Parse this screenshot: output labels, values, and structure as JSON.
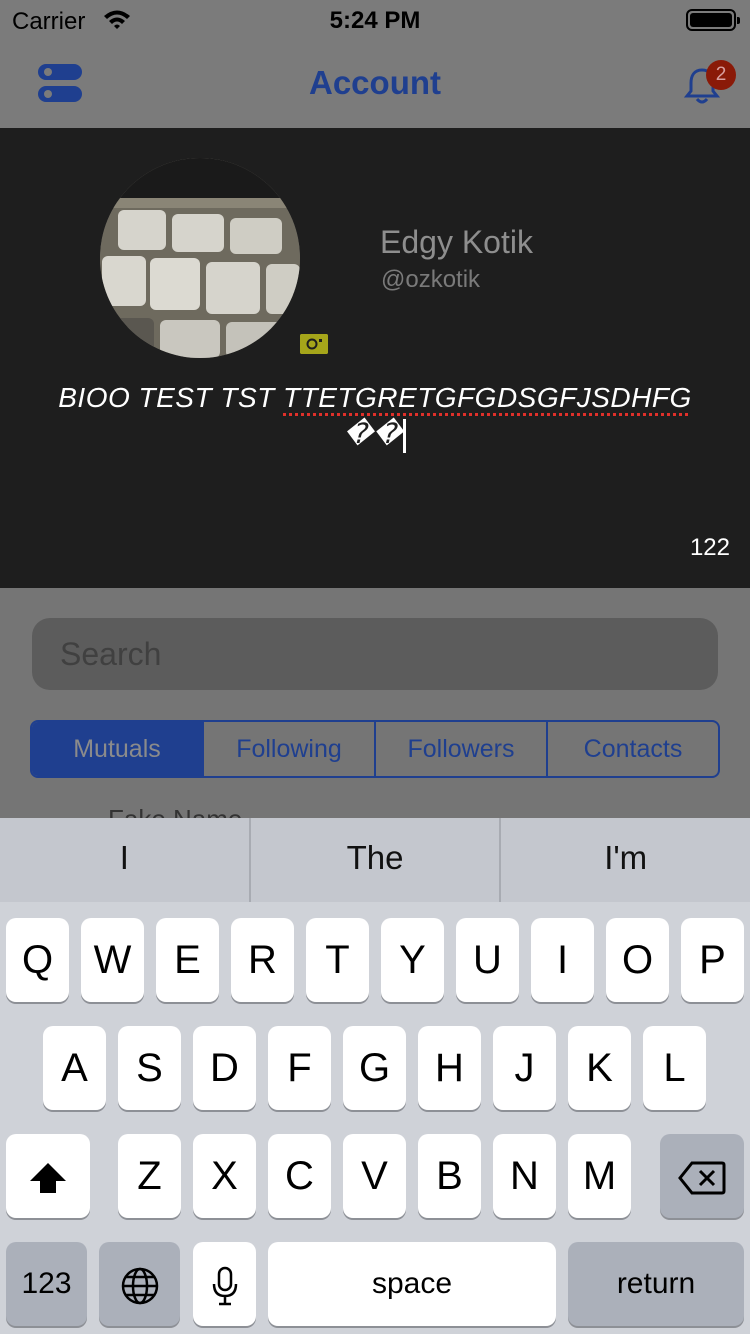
{
  "status_bar": {
    "carrier": "Carrier",
    "time": "5:24 PM"
  },
  "nav": {
    "title": "Account",
    "notification_count": "2"
  },
  "profile": {
    "name": "Edgy Kotik",
    "handle": "@ozkotik",
    "bio_plain": "BIOO TEST TST ",
    "bio_misspelled": "TTETGRETGFGDSGFJSDHFG",
    "bio_tail": "��",
    "char_count": "122"
  },
  "search": {
    "placeholder": "Search"
  },
  "segments": [
    "Mutuals",
    "Following",
    "Followers",
    "Contacts"
  ],
  "list_peek": "Fake Name",
  "keyboard": {
    "suggestions": [
      "I",
      "The",
      "I'm"
    ],
    "row1": [
      "Q",
      "W",
      "E",
      "R",
      "T",
      "Y",
      "U",
      "I",
      "O",
      "P"
    ],
    "row2": [
      "A",
      "S",
      "D",
      "F",
      "G",
      "H",
      "J",
      "K",
      "L"
    ],
    "row3": [
      "Z",
      "X",
      "C",
      "V",
      "B",
      "N",
      "M"
    ],
    "numbers_label": "123",
    "space_label": "space",
    "return_label": "return"
  },
  "colors": {
    "accent": "#1f3f8f",
    "badge": "#8a1a08",
    "profile_bg": "#1e1e1e"
  },
  "icons": [
    "wifi-icon",
    "battery-icon",
    "menu-toggle-icon",
    "bell-icon",
    "camera-icon",
    "shift-icon",
    "backspace-icon",
    "globe-icon",
    "microphone-icon"
  ]
}
